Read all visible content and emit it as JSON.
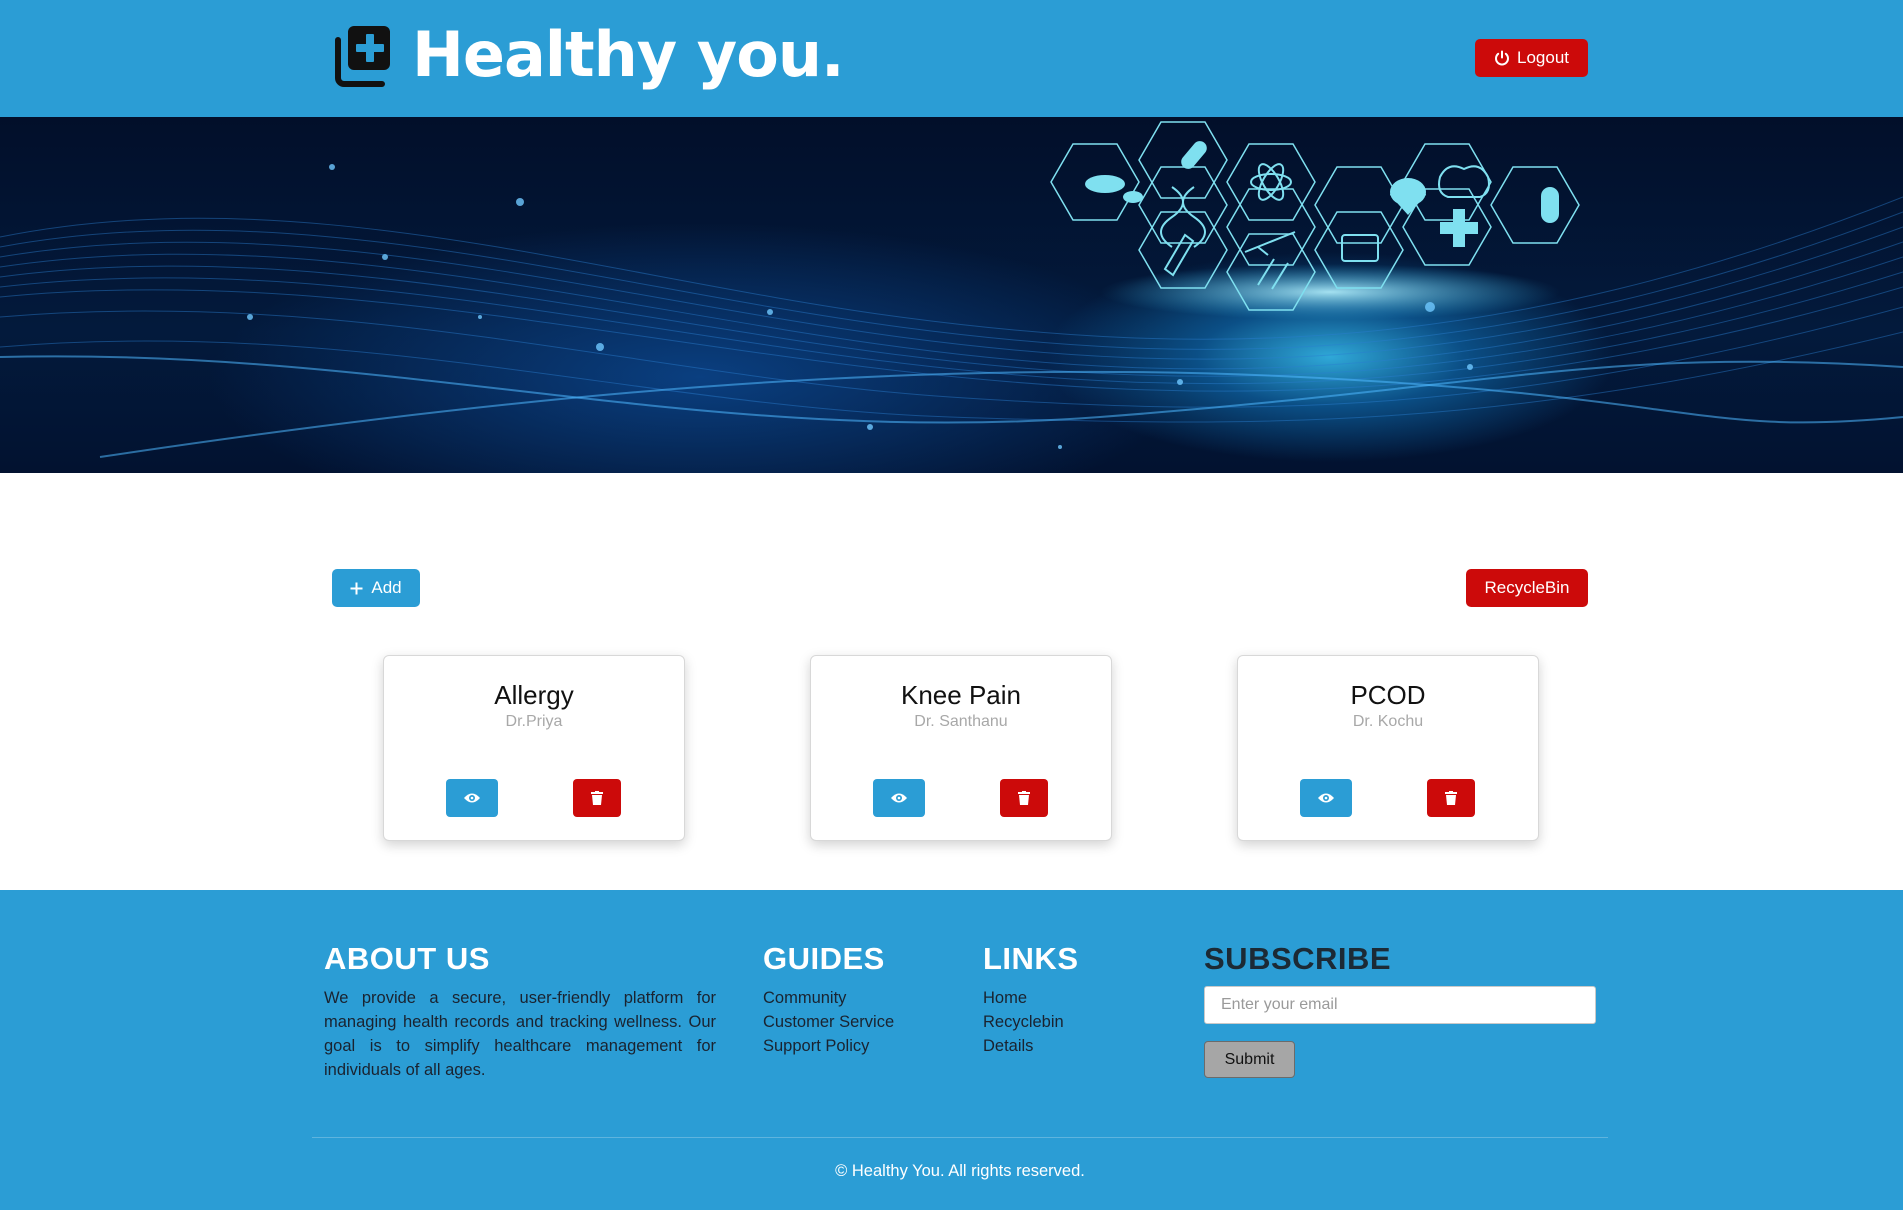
{
  "header": {
    "brand_title": "Healthy you.",
    "brand_icon": "medical-plus-icon",
    "logout_label": "Logout",
    "logout_icon": "power-icon"
  },
  "hero": {
    "image": "medical-technology-banner",
    "icons": [
      "pills-icon",
      "capsule-icon",
      "atom-icon",
      "brain-icon",
      "dna-icon",
      "heart-icon",
      "cross-icon",
      "pill-icon",
      "thermometer-icon",
      "syringe-icon",
      "monitor-icon",
      "test-tubes-icon"
    ]
  },
  "actions": {
    "add_label": "Add",
    "add_icon": "plus-icon",
    "recycle_label": "RecycleBin"
  },
  "cards": [
    {
      "title": "Allergy",
      "doctor": "Dr.Priya"
    },
    {
      "title": "Knee Pain",
      "doctor": "Dr. Santhanu"
    },
    {
      "title": "PCOD",
      "doctor": "Dr. Kochu"
    }
  ],
  "footer": {
    "about": {
      "title": "ABOUT US",
      "text": "We provide a secure, user-friendly platform for managing health records and tracking wellness. Our goal is to simplify healthcare management for individuals of all ages."
    },
    "guides": {
      "title": "GUIDES",
      "items": [
        "Community",
        "Customer Service",
        "Support Policy"
      ]
    },
    "links": {
      "title": "LINKS",
      "items": [
        "Home",
        "Recyclebin",
        "Details"
      ]
    },
    "subscribe": {
      "title": "SUBSCRIBE",
      "placeholder": "Enter your email",
      "submit_label": "Submit"
    },
    "copyright": "© Healthy You. All rights reserved."
  },
  "colors": {
    "primary": "#2b9dd5",
    "danger": "#cc0a0a",
    "white": "#ffffff"
  }
}
